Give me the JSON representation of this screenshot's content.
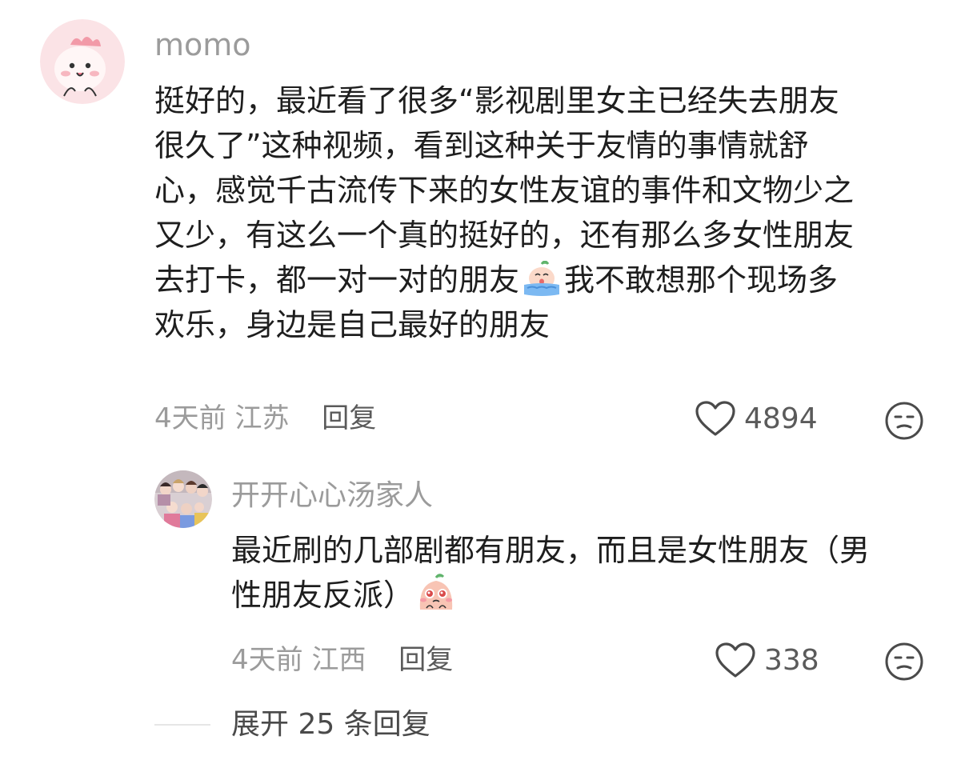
{
  "comment": {
    "username": "momo",
    "avatar_icon": "pink-cat-avatar",
    "content_lines": [
      "挺好的，最近看了很多“影视剧里女主已经失去朋友",
      "很久了”这种视频，看到这种关于友情的事情就舒",
      "心，感觉千古流传下来的女性友谊的事件和文物少之",
      "又少，有这么一个真的挺好的，还有那么多女性朋友"
    ],
    "line5_before": "去打卡，都一对一对的朋友",
    "line5_emoji": "crying-face-emoji",
    "line5_after": "我不敢想那个现场多",
    "line6": "欢乐，身边是自己最好的朋友",
    "time": "4天前",
    "location": "江苏",
    "reply_label": "回复",
    "likes": "4894",
    "like_icon": "heart-icon",
    "dislike_icon": "unamused-face-icon"
  },
  "reply": {
    "username": "开开心心汤家人",
    "avatar_icon": "group-photo-avatar",
    "line1": "最近刷的几部剧都有朋友，而且是女性朋友（男",
    "line2_before": "性朋友反派）",
    "line2_emoji": "pleading-face-emoji",
    "time": "4天前",
    "location": "江西",
    "reply_label": "回复",
    "likes": "338",
    "like_icon": "heart-icon",
    "dislike_icon": "unamused-face-icon"
  },
  "expand": {
    "label": "展开 25 条回复"
  },
  "colors": {
    "secondary_text": "#9b9b9b",
    "primary_text": "#1e1e1e",
    "action_text": "#5a5a5a"
  }
}
